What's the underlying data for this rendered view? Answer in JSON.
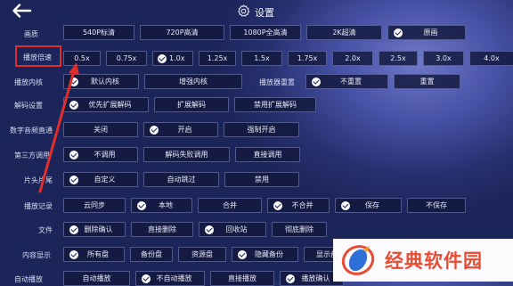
{
  "header": {
    "title": "设置"
  },
  "labels": {
    "quality": "画质",
    "speed": "播放倍速",
    "core": "播放内核",
    "decode": "解码设置",
    "audio": "数字音频直通",
    "third": "第三方调用",
    "skip": "片头片尾",
    "record": "播放记录",
    "file": "文件",
    "content": "内容显示",
    "autoplay": "自动播放"
  },
  "quality": [
    "540P标清",
    "720P高清",
    "1080P全高清",
    "2K超清",
    "原画"
  ],
  "speed": [
    "0.5x",
    "0.75x",
    "1.0x",
    "1.25x",
    "1.5x",
    "1.75x",
    "2.0x",
    "2.5x",
    "3.0x",
    "4.0x"
  ],
  "core": {
    "default": "默认内核",
    "enhanced": "增强内核",
    "reset_label": "播放器重置",
    "no_reset": "不重置",
    "reset": "重置"
  },
  "decode": [
    "优先扩展解码",
    "扩展解码",
    "禁用扩展解码"
  ],
  "audio": [
    "关闭",
    "开启",
    "强制开启"
  ],
  "third": [
    "不调用",
    "解码失败调用",
    "直接调用"
  ],
  "skip": [
    "自定义",
    "自动跳过",
    "禁用"
  ],
  "record": [
    "云同步",
    "本地",
    "合并",
    "不合并",
    "保存",
    "不保存"
  ],
  "file": [
    "删除确认",
    "直接删除",
    "回收站",
    "彻底删除"
  ],
  "content": [
    "所有盘",
    "备份盘",
    "资源盘",
    "隐藏备份",
    "显示备份"
  ],
  "autoplay": [
    "自动播放",
    "不自动播放",
    "直接播放",
    "播放确认"
  ],
  "watermark": {
    "text": "经典软件园"
  },
  "colors": {
    "accent": "#e02d2d",
    "watermark": "#ea4b33"
  }
}
